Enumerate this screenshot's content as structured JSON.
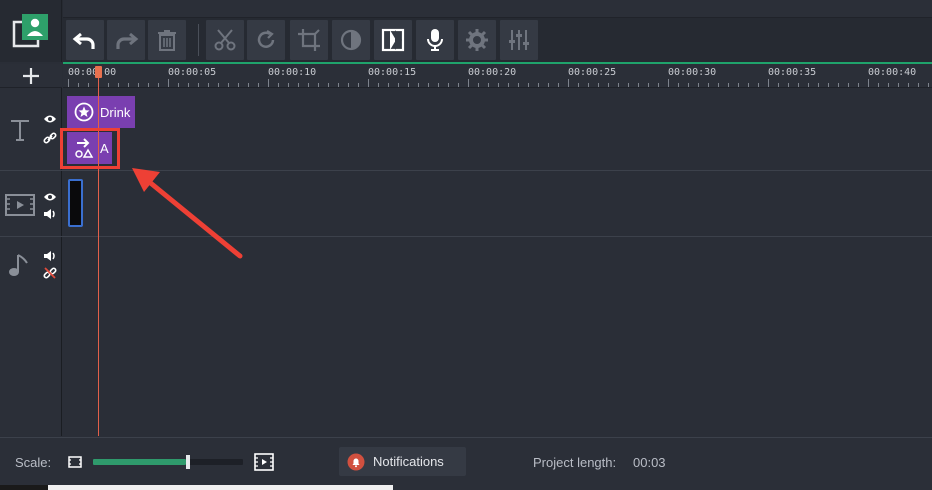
{
  "toolbar": {
    "buttons": [
      {
        "name": "undo-button",
        "icon": "undo-icon",
        "enabled": true
      },
      {
        "name": "redo-button",
        "icon": "redo-icon",
        "enabled": false
      },
      {
        "name": "delete-button",
        "icon": "trash-icon",
        "enabled": false
      },
      {
        "name": "cut-button",
        "icon": "scissors-icon",
        "enabled": false
      },
      {
        "name": "rotate-button",
        "icon": "rotate-icon",
        "enabled": false
      },
      {
        "name": "crop-button",
        "icon": "crop-icon",
        "enabled": false
      },
      {
        "name": "color-adjust-button",
        "icon": "contrast-icon",
        "enabled": false
      },
      {
        "name": "transition-button",
        "icon": "transition-icon",
        "enabled": true
      },
      {
        "name": "record-voice-button",
        "icon": "microphone-icon",
        "enabled": true
      },
      {
        "name": "clip-properties-button",
        "icon": "gear-icon",
        "enabled": false
      },
      {
        "name": "equalizer-button",
        "icon": "sliders-icon",
        "enabled": false
      }
    ]
  },
  "ruler": {
    "labels": [
      "00:00:00",
      "00:00:05",
      "00:00:10",
      "00:00:15",
      "00:00:20",
      "00:00:25",
      "00:00:30",
      "00:00:35",
      "00:00:40"
    ]
  },
  "tracks": {
    "title_clips": [
      {
        "label": "Drink",
        "icon": "star-icon"
      },
      {
        "label": "A",
        "icon": "shapes-icon"
      }
    ]
  },
  "bottom": {
    "scale_label": "Scale:",
    "scale_level": 0.62,
    "notifications_label": "Notifications",
    "project_length_label": "Project length:",
    "project_length_value": "00:03"
  },
  "colors": {
    "accent": "#1fa36b",
    "clip": "#7a3fb0",
    "highlight": "#ee4035",
    "playhead": "#e2604a"
  }
}
